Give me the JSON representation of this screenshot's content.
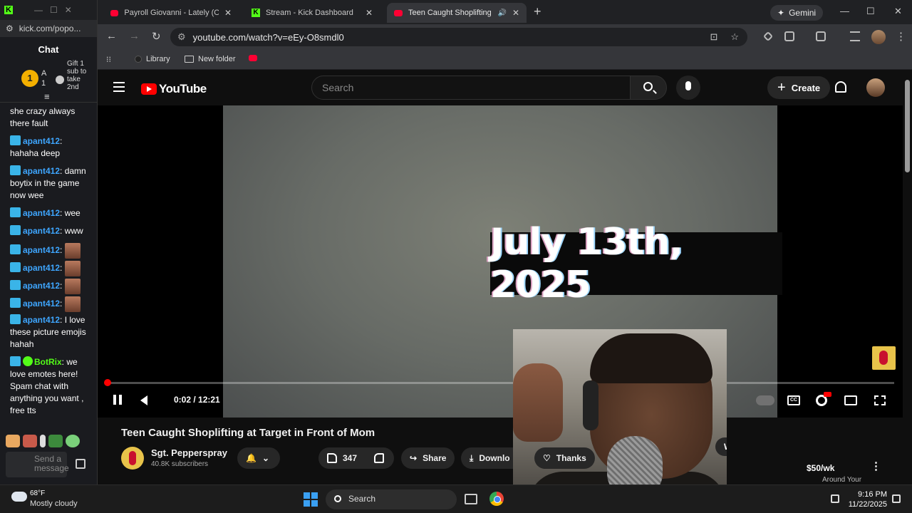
{
  "chat_window": {
    "url": "kick.com/popo...",
    "title": "Chat",
    "pinned": {
      "rank": "1",
      "user": "A",
      "count": "1",
      "gift_text": "Gift 1 sub to take 2nd"
    },
    "messages": [
      {
        "user": "",
        "text": "she crazy always there fault",
        "emotes": 0
      },
      {
        "user": "apant412",
        "text": ": hahaha deep",
        "emotes": 0
      },
      {
        "user": "apant412",
        "text": ": damn boytix in the game now wee",
        "emotes": 0
      },
      {
        "user": "apant412",
        "text": ": wee",
        "emotes": 0
      },
      {
        "user": "apant412",
        "text": ": www",
        "emotes": 0
      },
      {
        "user": "apant412",
        "text": ":",
        "emotes": 1
      },
      {
        "user": "apant412",
        "text": ":",
        "emotes": 1
      },
      {
        "user": "apant412",
        "text": ":",
        "emotes": 1
      },
      {
        "user": "apant412",
        "text": ":",
        "emotes": 1
      },
      {
        "user": "apant412",
        "text": ": I love these picture emojis hahah",
        "emotes": 0
      },
      {
        "user": "BotRix",
        "text": ": we love emotes here! Spam chat with anything you want , free tts",
        "emotes": 0,
        "bot": true
      }
    ],
    "send_placeholder": "Send a message"
  },
  "browser": {
    "tabs": [
      {
        "label": "Payroll Giovanni - Lately (Offici",
        "icon": "youtube-icon",
        "active": false
      },
      {
        "label": "Stream - Kick Dashboard",
        "icon": "kick-icon",
        "active": false
      },
      {
        "label": "Teen Caught Shoplifting at",
        "icon": "youtube-icon",
        "active": true
      }
    ],
    "gemini_label": "Gemini",
    "url": "youtube.com/watch?v=eEy-O8smdl0",
    "bookmarks": [
      {
        "label": "Library",
        "icon": "library-icon"
      },
      {
        "label": "New folder",
        "icon": "folder-icon"
      }
    ]
  },
  "youtube": {
    "logo_text": "YouTube",
    "search_placeholder": "Search",
    "create_label": "Create",
    "player": {
      "overlay_text": "July 13th, 2025",
      "time": "0:02 / 12:21",
      "progress": 0.003
    },
    "video_title": "Teen Caught Shoplifting at Target in Front of Mom",
    "channel_name": "Sgt. Pepperspray",
    "subscribers": "40.8K subscribers",
    "likes": "347",
    "share_label": "Share",
    "download_label": "Downlo",
    "thanks_label": "Thanks",
    "watched_label": "Watched",
    "price_label": "$50/wk",
    "ad_text": "Around Your"
  },
  "taskbar": {
    "temperature": "68°F",
    "condition": "Mostly cloudy",
    "search_label": "Search",
    "time": "9:16 PM",
    "date": "11/22/2025"
  },
  "colors": {
    "kick_green": "#53fc18",
    "youtube_red": "#ff0000",
    "chat_username": "#3ea6ff"
  }
}
